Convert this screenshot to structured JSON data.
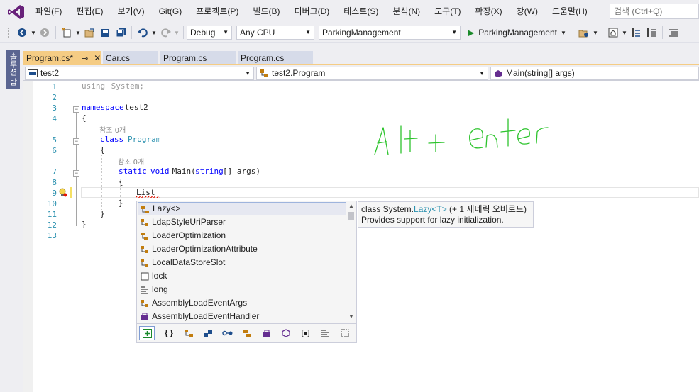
{
  "app": {
    "accent": "#68217a",
    "menu_bg": "#eeeef2"
  },
  "menu": {
    "items": [
      "파일(F)",
      "편집(E)",
      "보기(V)",
      "Git(G)",
      "프로젝트(P)",
      "빌드(B)",
      "디버그(D)",
      "테스트(S)",
      "분석(N)",
      "도구(T)",
      "확장(X)",
      "창(W)",
      "도움말(H)"
    ],
    "search_placeholder": "검색 (Ctrl+Q)"
  },
  "toolbar": {
    "config": "Debug",
    "platform": "Any CPU",
    "project": "ParkingManagement",
    "run_target": "ParkingManagement"
  },
  "side_panel": {
    "label": "솔루션 탐"
  },
  "tabs": [
    {
      "label": "Program.cs*",
      "active": true,
      "pinned": true
    },
    {
      "label": "Car.cs"
    },
    {
      "label": "Program.cs"
    },
    {
      "label": "Program.cs"
    }
  ],
  "navbar": {
    "project": "test2",
    "type": "test2.Program",
    "member": "Main(string[] args)"
  },
  "code": {
    "line_numbers": [
      "1",
      "2",
      "3",
      "4",
      "5",
      "6",
      "7",
      "8",
      "9",
      "10",
      "11",
      "12",
      "13"
    ],
    "l1_using": "using",
    "l1_ns": " System;",
    "l3_kw": "namespace",
    "l3_name": " test2",
    "brace_open": "{",
    "brace_close": "}",
    "ref_count": "참조 0개",
    "l5_kw": "class",
    "l5_name": "Program",
    "l7_static": "static",
    "l7_void": "void",
    "l7_main": " Main(",
    "l7_string": "string",
    "l7_rest": "[] args)",
    "l9_text": "List"
  },
  "completion": {
    "items": [
      {
        "label": "Lazy<>",
        "icon": "class-icon"
      },
      {
        "label": "LdapStyleUriParser",
        "icon": "class-icon"
      },
      {
        "label": "LoaderOptimization",
        "icon": "enum-icon"
      },
      {
        "label": "LoaderOptimizationAttribute",
        "icon": "class-icon"
      },
      {
        "label": "LocalDataStoreSlot",
        "icon": "class-icon"
      },
      {
        "label": "lock",
        "icon": "snippet-icon"
      },
      {
        "label": "long",
        "icon": "keyword-icon"
      },
      {
        "label": "AssemblyLoadEventArgs",
        "icon": "class-icon"
      },
      {
        "label": "AssemblyLoadEventHandler",
        "icon": "delegate-icon"
      }
    ],
    "filters": [
      "namespace-filter-icon",
      "class-filter-icon",
      "struct-filter-icon",
      "interface-filter-icon",
      "enum-filter-icon",
      "delegate-filter-icon",
      "module-filter-icon",
      "value-filter-icon",
      "keyword-filter-icon",
      "snippet-filter-icon"
    ]
  },
  "tooltip": {
    "prefix": "class System.",
    "type_name": "Lazy<T>",
    "suffix": " (+ 1 제네릭 오버로드)",
    "description": "Provides support for lazy initialization."
  },
  "annotation": {
    "color": "#2ec42e",
    "note": "Alt + enter"
  }
}
